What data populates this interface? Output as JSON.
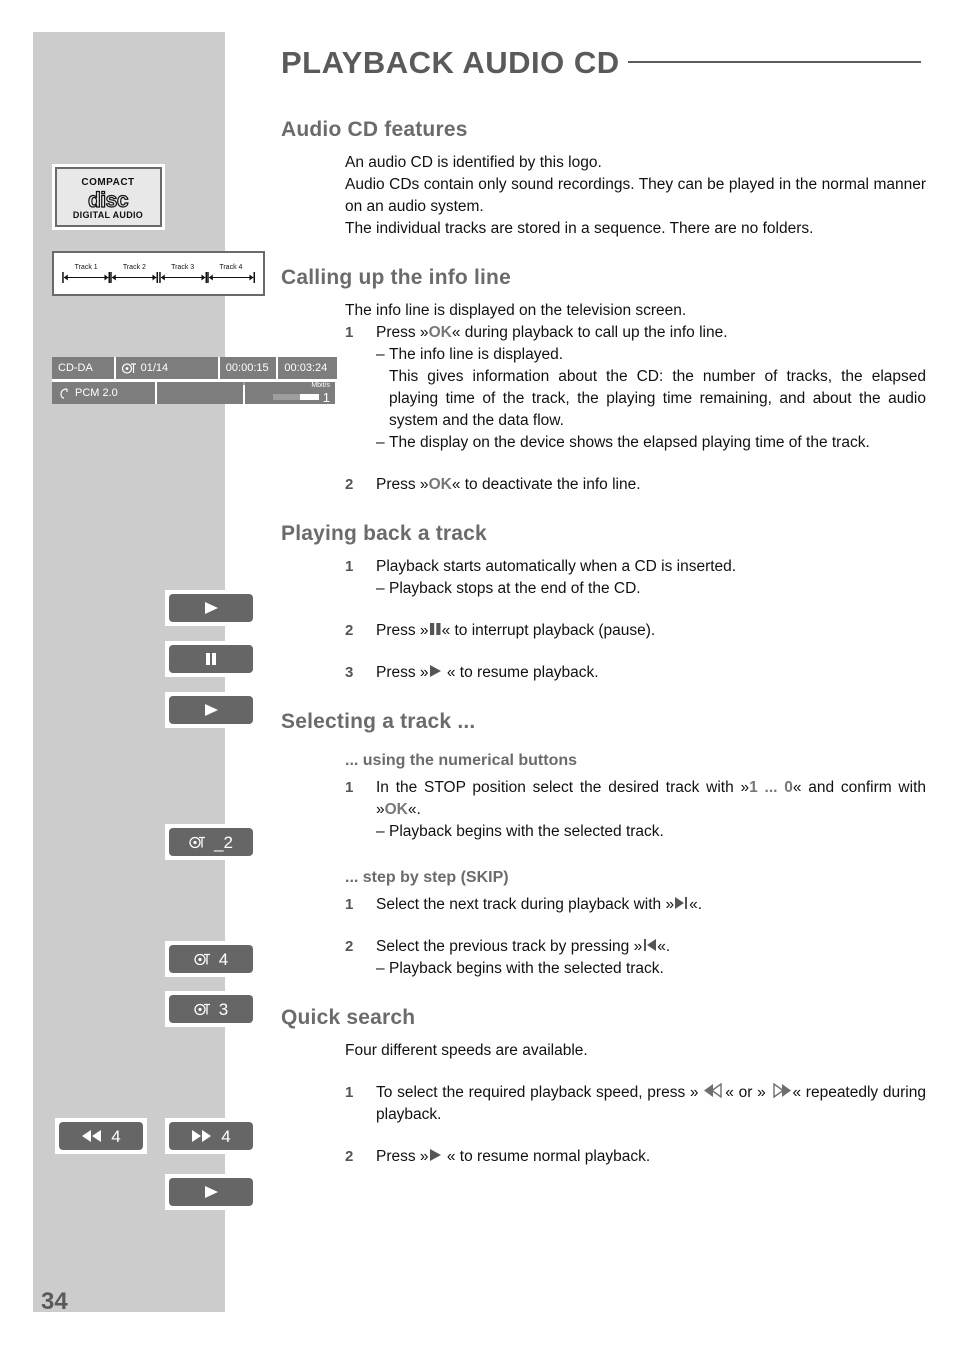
{
  "header": {
    "title": "PLAYBACK AUDIO CD"
  },
  "page_number": "34",
  "sections": {
    "audio_cd_features": {
      "heading": "Audio CD features",
      "lines": [
        "An audio CD is identified by this logo.",
        "Audio CDs contain only sound recordings. They can be played in the normal manner on an audio system.",
        "The individual tracks are stored in a sequence. There are no folders."
      ]
    },
    "info_line": {
      "heading": "Calling up the info line",
      "intro": "The info line is displayed on the television screen.",
      "step1_num": "1",
      "step1_pre": "Press »",
      "step1_key": "OK",
      "step1_post": "« during playback to call up the info line.",
      "sub1_dash": "–",
      "sub1": "The info line is displayed.",
      "sub1_cont": "This gives information about the CD: the number of tracks, the elapsed playing time of the track, the playing time remaining, and about the audio system and the data flow.",
      "sub2_dash": "–",
      "sub2": "The display on the device shows the elapsed playing time of the track.",
      "step2_num": "2",
      "step2_pre": "Press »",
      "step2_key": "OK",
      "step2_post": "« to deactivate the info line."
    },
    "playing_back": {
      "heading": "Playing back a track",
      "step1_num": "1",
      "step1": "Playback starts automatically when a CD is inserted.",
      "sub1_dash": "–",
      "sub1": "Playback stops at the end of the CD.",
      "step2_num": "2",
      "step2_pre": "Press »",
      "step2_post": "« to interrupt playback (pause).",
      "step3_num": "3",
      "step3_pre": "Press »",
      "step3_post": " « to resume playback."
    },
    "selecting_track": {
      "heading": "Selecting a track ...",
      "numerical": {
        "heading": "... using the numerical buttons",
        "step1_num": "1",
        "step1_a": "In the STOP position select the desired track with »",
        "step1_key1": "1 ... 0",
        "step1_b": "« and confirm with »",
        "step1_key2": "OK",
        "step1_c": "«.",
        "sub1_dash": "–",
        "sub1": "Playback begins with the selected track."
      },
      "skip": {
        "heading": "... step by step (SKIP)",
        "step1_num": "1",
        "step1_pre": "Select the next track during playback with »",
        "step1_post": "«.",
        "step2_num": "2",
        "step2_pre": "Select the previous track by pressing »",
        "step2_post": "«.",
        "sub2_dash": "–",
        "sub2": "Playback begins with the selected track."
      }
    },
    "quick_search": {
      "heading": "Quick search",
      "intro": "Four different speeds are available.",
      "step1_num": "1",
      "step1_a": "To select the required playback speed, press » ",
      "step1_b": "« or » ",
      "step1_c": "« repeatedly during playback.",
      "step2_num": "2",
      "step2_pre": "Press »",
      "step2_post": " « to resume normal playback."
    }
  },
  "figures": {
    "cd_logo": {
      "line1": "COMPACT",
      "line2": "disc",
      "line3": "DIGITAL AUDIO"
    },
    "track_diagram": {
      "tracks": [
        "Track 1",
        "Track 2",
        "Track 3",
        "Track 4"
      ]
    },
    "osd_info_line": {
      "format": "CD-DA",
      "track": "01/14",
      "elapsed": "00:00:15",
      "remaining": "00:03:24",
      "audio": "PCM 2.0",
      "bitrate_label": "Mbit/s",
      "bitrate_value": "1"
    },
    "key_displays": {
      "play_1": "",
      "pause": "",
      "play_2": "",
      "track_select": "_2",
      "skip_next": "4",
      "skip_prev": "3",
      "rewind": "4",
      "forward": "4",
      "play_3": ""
    }
  },
  "colors": {
    "sidebar_band": "#cccccc",
    "heading_gray": "#6b6b6b",
    "key_box": "#666666",
    "osd_gray": "#7d7d7d"
  }
}
